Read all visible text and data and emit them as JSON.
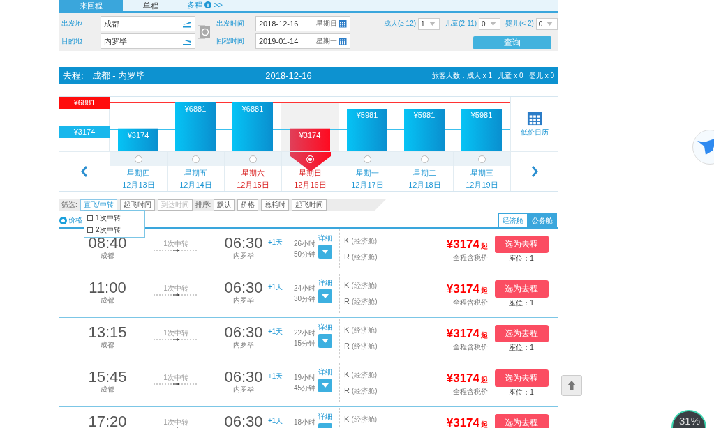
{
  "trip_tabs": [
    {
      "label": "来回程",
      "selected": true
    },
    {
      "label": "单程",
      "selected": false
    },
    {
      "label": "多程",
      "selected": false,
      "kind": "link",
      "suffix": ">>"
    }
  ],
  "search_form": {
    "from": {
      "label": "出发地",
      "value": "成都"
    },
    "to": {
      "label": "目的地",
      "value": "内罗毕"
    },
    "depart": {
      "label": "出发时间",
      "value": "2018-12-16",
      "weekday": "星期日"
    },
    "return": {
      "label": "回程时间",
      "value": "2019-01-14",
      "weekday": "星期一"
    },
    "passengers": [
      {
        "label": "成人(≥ 12)",
        "value": "1"
      },
      {
        "label": "儿童(2-11)",
        "value": "0"
      },
      {
        "label": "婴儿(< 2)",
        "value": "0"
      }
    ],
    "submit": "查询"
  },
  "route_header": {
    "direction": "去程:",
    "route": "成都 - 内罗毕",
    "date": "2018-12-16",
    "travelers": "旅客人数：成人 x 1   儿童 x 0   婴儿 x 0"
  },
  "price_chart": {
    "max_label": "¥6881",
    "min_label": "¥3174",
    "calendar_label": "低价日历",
    "chart_data": {
      "type": "bar",
      "categories": [
        "12月13日",
        "12月14日",
        "12月15日",
        "12月16日",
        "12月17日",
        "12月18日",
        "12月19日"
      ],
      "values": [
        3174,
        6881,
        6881,
        3174,
        5981,
        5981,
        5981
      ],
      "ylim": [
        0,
        6881
      ],
      "data_labels": true,
      "value_labels": [
        "¥3174",
        "¥6881",
        "¥6881",
        "¥3174",
        "¥5981",
        "¥5981",
        "¥5981"
      ]
    },
    "days": [
      {
        "weekday": "星期四",
        "weekend": false,
        "selected": false
      },
      {
        "weekday": "星期五",
        "weekend": false,
        "selected": false
      },
      {
        "weekday": "星期六",
        "weekend": true,
        "selected": false
      },
      {
        "weekday": "星期日",
        "weekend": true,
        "selected": true
      },
      {
        "weekday": "星期一",
        "weekend": false,
        "selected": false
      },
      {
        "weekday": "星期二",
        "weekend": false,
        "selected": false
      },
      {
        "weekday": "星期三",
        "weekend": false,
        "selected": false
      }
    ]
  },
  "filter_bar": {
    "filter_label": "筛选:",
    "filters": [
      {
        "label": "直飞/中转",
        "selected": true,
        "disabled": false
      },
      {
        "label": "起飞时间",
        "selected": false,
        "disabled": false
      },
      {
        "label": "到达时间",
        "selected": false,
        "disabled": true
      }
    ],
    "sort_label": "排序:",
    "sorts": [
      "默认",
      "价格",
      "总耗时",
      "起飞时间"
    ],
    "dropdown": [
      {
        "label": "1次中转",
        "checked": false
      },
      {
        "label": "2次中转",
        "checked": false
      }
    ]
  },
  "list_header": {
    "label": "价格",
    "cabin_tabs": [
      {
        "label": "经济舱",
        "selected": true
      },
      {
        "label": "公务舱",
        "selected": false
      }
    ]
  },
  "flights": [
    {
      "depart_time": "08:40",
      "depart_city": "成都",
      "stops": "1次中转",
      "arrive_time": "06:30",
      "day_offset": "+1天",
      "arrive_city": "内罗毕",
      "duration": [
        "26小时",
        "50分钟"
      ],
      "detail": "详细",
      "cabins": [
        {
          "code": "K",
          "name": "(经济舱)"
        },
        {
          "code": "R",
          "name": "(经济舱)"
        }
      ],
      "price": "¥3174",
      "price_suffix": "起",
      "price_note": "全程含税价",
      "action": "选为去程",
      "seats": "座位：1"
    },
    {
      "depart_time": "11:00",
      "depart_city": "成都",
      "stops": "1次中转",
      "arrive_time": "06:30",
      "day_offset": "+1天",
      "arrive_city": "内罗毕",
      "duration": [
        "24小时",
        "30分钟"
      ],
      "detail": "详细",
      "cabins": [
        {
          "code": "K",
          "name": "(经济舱)"
        },
        {
          "code": "R",
          "name": "(经济舱)"
        }
      ],
      "price": "¥3174",
      "price_suffix": "起",
      "price_note": "全程含税价",
      "action": "选为去程",
      "seats": "座位：1"
    },
    {
      "depart_time": "13:15",
      "depart_city": "成都",
      "stops": "1次中转",
      "arrive_time": "06:30",
      "day_offset": "+1天",
      "arrive_city": "内罗毕",
      "duration": [
        "22小时",
        "15分钟"
      ],
      "detail": "详细",
      "cabins": [
        {
          "code": "K",
          "name": "(经济舱)"
        },
        {
          "code": "R",
          "name": "(经济舱)"
        }
      ],
      "price": "¥3174",
      "price_suffix": "起",
      "price_note": "全程含税价",
      "action": "选为去程",
      "seats": "座位：1"
    },
    {
      "depart_time": "15:45",
      "depart_city": "成都",
      "stops": "1次中转",
      "arrive_time": "06:30",
      "day_offset": "+1天",
      "arrive_city": "内罗毕",
      "duration": [
        "19小时",
        "45分钟"
      ],
      "detail": "详细",
      "cabins": [
        {
          "code": "K",
          "name": "(经济舱)"
        },
        {
          "code": "R",
          "name": "(经济舱)"
        }
      ],
      "price": "¥3174",
      "price_suffix": "起",
      "price_note": "全程含税价",
      "action": "选为去程",
      "seats": "座位：1"
    },
    {
      "depart_time": "17:20",
      "stops": "1次中转",
      "arrive_time": "06:30",
      "day_offset": "+1天",
      "duration": [
        "18小时"
      ],
      "detail": "详细",
      "cabins": [
        {
          "code": "K",
          "name": "(经济舱)"
        }
      ],
      "price": "¥3174",
      "price_suffix": "起",
      "action": "选为去程"
    }
  ],
  "speed_widget": {
    "value": "31%"
  }
}
